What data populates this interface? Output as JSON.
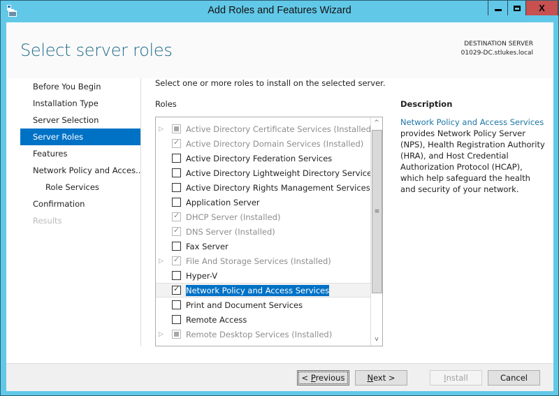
{
  "window": {
    "title": "Add Roles and Features Wizard",
    "icon": "server-manager-icon",
    "caption_buttons": [
      "minimize",
      "maximize",
      "close"
    ]
  },
  "header": {
    "page_title": "Select server roles",
    "destination_label": "DESTINATION SERVER",
    "destination_server": "01029-DC.stlukes.local"
  },
  "nav": {
    "items": [
      {
        "label": "Before You Begin",
        "state": "normal"
      },
      {
        "label": "Installation Type",
        "state": "normal"
      },
      {
        "label": "Server Selection",
        "state": "normal"
      },
      {
        "label": "Server Roles",
        "state": "active"
      },
      {
        "label": "Features",
        "state": "normal"
      },
      {
        "label": "Network Policy and Acces...",
        "state": "normal"
      },
      {
        "label": "Role Services",
        "state": "sub"
      },
      {
        "label": "Confirmation",
        "state": "normal"
      },
      {
        "label": "Results",
        "state": "disabled"
      }
    ]
  },
  "main": {
    "instruction": "Select one or more roles to install on the selected server.",
    "roles_label": "Roles",
    "roles": [
      {
        "label": "Active Directory Certificate Services (Installed)",
        "expandable": true,
        "check": "indeterminate",
        "disabled": true
      },
      {
        "label": "Active Directory Domain Services (Installed)",
        "expandable": false,
        "check": "checked",
        "disabled": true
      },
      {
        "label": "Active Directory Federation Services",
        "expandable": false,
        "check": "unchecked",
        "disabled": false
      },
      {
        "label": "Active Directory Lightweight Directory Services",
        "expandable": false,
        "check": "unchecked",
        "disabled": false
      },
      {
        "label": "Active Directory Rights Management Services",
        "expandable": false,
        "check": "unchecked",
        "disabled": false
      },
      {
        "label": "Application Server",
        "expandable": false,
        "check": "unchecked",
        "disabled": false
      },
      {
        "label": "DHCP Server (Installed)",
        "expandable": false,
        "check": "checked",
        "disabled": true
      },
      {
        "label": "DNS Server (Installed)",
        "expandable": false,
        "check": "checked",
        "disabled": true
      },
      {
        "label": "Fax Server",
        "expandable": false,
        "check": "unchecked",
        "disabled": false
      },
      {
        "label": "File And Storage Services (Installed)",
        "expandable": true,
        "check": "checked",
        "disabled": true
      },
      {
        "label": "Hyper-V",
        "expandable": false,
        "check": "unchecked",
        "disabled": false
      },
      {
        "label": "Network Policy and Access Services",
        "expandable": false,
        "check": "checked",
        "disabled": false,
        "selected": true
      },
      {
        "label": "Print and Document Services",
        "expandable": false,
        "check": "unchecked",
        "disabled": false
      },
      {
        "label": "Remote Access",
        "expandable": false,
        "check": "unchecked",
        "disabled": false
      },
      {
        "label": "Remote Desktop Services (Installed)",
        "expandable": true,
        "check": "indeterminate",
        "disabled": true
      }
    ],
    "scrollbar": {
      "up": "^",
      "down": "v",
      "grip": "≡"
    }
  },
  "description": {
    "title": "Description",
    "link": "Network Policy and Access Services",
    "text": " provides Network Policy Server (NPS), Health Registration Authority (HRA), and Host Credential Authorization Protocol (HCAP), which help safeguard the health and security of your network."
  },
  "footer": {
    "previous": {
      "prefix": "< ",
      "accel": "P",
      "rest": "revious"
    },
    "next": {
      "prefix": "",
      "accel": "N",
      "rest": "ext >"
    },
    "install": {
      "prefix": "",
      "accel": "I",
      "rest": "nstall",
      "disabled": true
    },
    "cancel": {
      "label": "Cancel"
    }
  }
}
